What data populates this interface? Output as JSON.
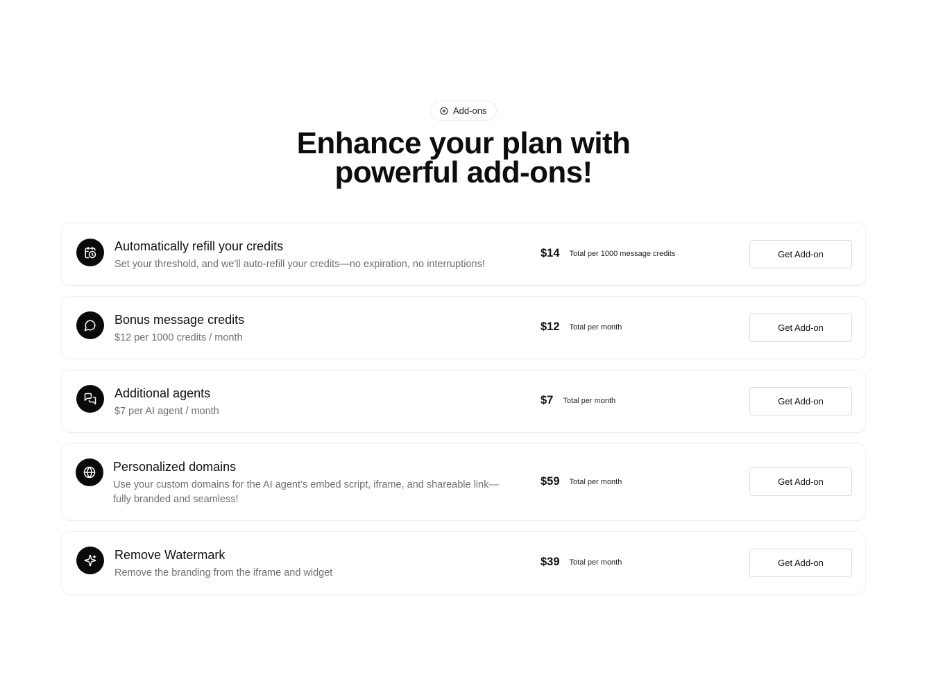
{
  "badge": {
    "label": "Add-ons",
    "icon": "plus-circle-icon"
  },
  "headline": {
    "line1": "Enhance your plan with",
    "line2": "powerful add-ons!"
  },
  "addons": [
    {
      "icon": "calendar-refresh-icon",
      "title": "Automatically refill your credits",
      "description": "Set your threshold, and we'll auto-refill your credits—no expiration, no interruptions!",
      "price": "$14",
      "price_note": "Total per 1000 message credits",
      "button_label": "Get Add-on"
    },
    {
      "icon": "message-circle-icon",
      "title": "Bonus message credits",
      "description": "$12 per 1000 credits / month",
      "price": "$12",
      "price_note": "Total per month",
      "button_label": "Get Add-on"
    },
    {
      "icon": "chat-bubbles-icon",
      "title": "Additional agents",
      "description": "$7 per AI agent / month",
      "price": "$7",
      "price_note": "Total per month",
      "button_label": "Get Add-on"
    },
    {
      "icon": "globe-icon",
      "title": "Personalized domains",
      "description": "Use your custom domains for the AI agent’s embed script, iframe, and shareable link—fully branded and seamless!",
      "price": "$59",
      "price_note": "Total per month",
      "button_label": "Get Add-on"
    },
    {
      "icon": "sparkles-icon",
      "title": "Remove Watermark",
      "description": "Remove the branding from the iframe and widget",
      "price": "$39",
      "price_note": "Total per month",
      "button_label": "Get Add-on"
    }
  ]
}
